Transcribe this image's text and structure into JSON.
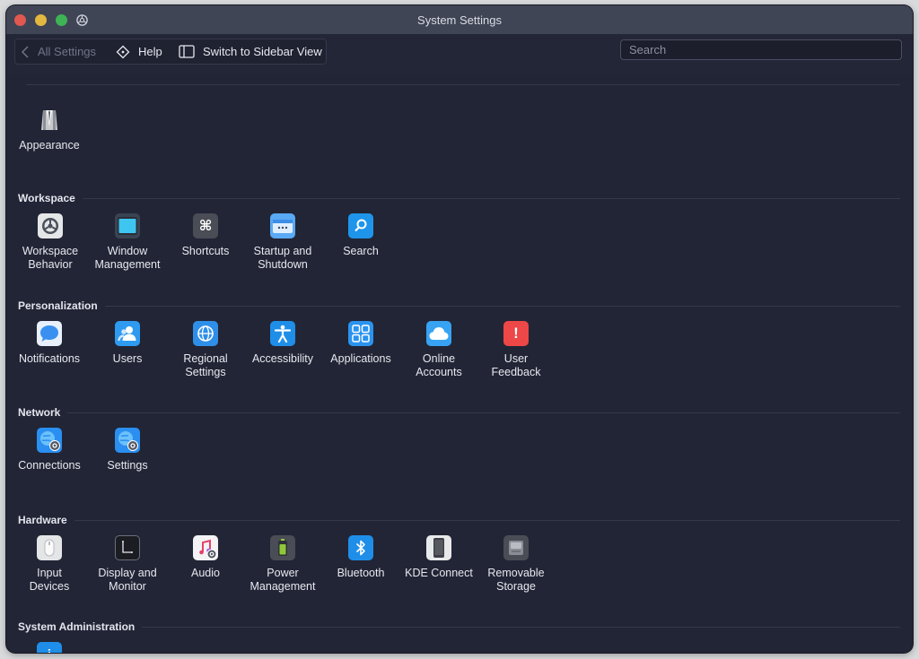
{
  "window": {
    "title": "System Settings"
  },
  "toolbar": {
    "back_label": "All Settings",
    "help_label": "Help",
    "sidebar_label": "Switch to Sidebar View",
    "search_placeholder": "Search"
  },
  "appearance": {
    "label": "Appearance"
  },
  "sections": {
    "workspace": {
      "title": "Workspace",
      "items": [
        {
          "label": "Workspace\nBehavior",
          "icon": "workspace-behavior-icon"
        },
        {
          "label": "Window\nManagement",
          "icon": "window-management-icon"
        },
        {
          "label": "Shortcuts",
          "icon": "command-key-icon"
        },
        {
          "label": "Startup and\nShutdown",
          "icon": "startup-icon"
        },
        {
          "label": "Search",
          "icon": "search-icon"
        }
      ]
    },
    "personalization": {
      "title": "Personalization",
      "items": [
        {
          "label": "Notifications",
          "icon": "notifications-icon"
        },
        {
          "label": "Users",
          "icon": "users-icon"
        },
        {
          "label": "Regional\nSettings",
          "icon": "globe-icon"
        },
        {
          "label": "Accessibility",
          "icon": "accessibility-icon"
        },
        {
          "label": "Applications",
          "icon": "applications-grid-icon"
        },
        {
          "label": "Online\nAccounts",
          "icon": "cloud-icon"
        },
        {
          "label": "User\nFeedback",
          "icon": "feedback-icon"
        }
      ]
    },
    "network": {
      "title": "Network",
      "items": [
        {
          "label": "Connections",
          "icon": "network-connections-icon"
        },
        {
          "label": "Settings",
          "icon": "network-settings-icon"
        }
      ]
    },
    "hardware": {
      "title": "Hardware",
      "items": [
        {
          "label": "Input\nDevices",
          "icon": "mouse-icon"
        },
        {
          "label": "Display and\nMonitor",
          "icon": "monitor-icon"
        },
        {
          "label": "Audio",
          "icon": "audio-icon"
        },
        {
          "label": "Power\nManagement",
          "icon": "battery-icon"
        },
        {
          "label": "Bluetooth",
          "icon": "bluetooth-icon"
        },
        {
          "label": "KDE Connect",
          "icon": "phone-icon"
        },
        {
          "label": "Removable\nStorage",
          "icon": "drive-icon"
        }
      ]
    },
    "sysadmin": {
      "title": "System Administration"
    }
  }
}
